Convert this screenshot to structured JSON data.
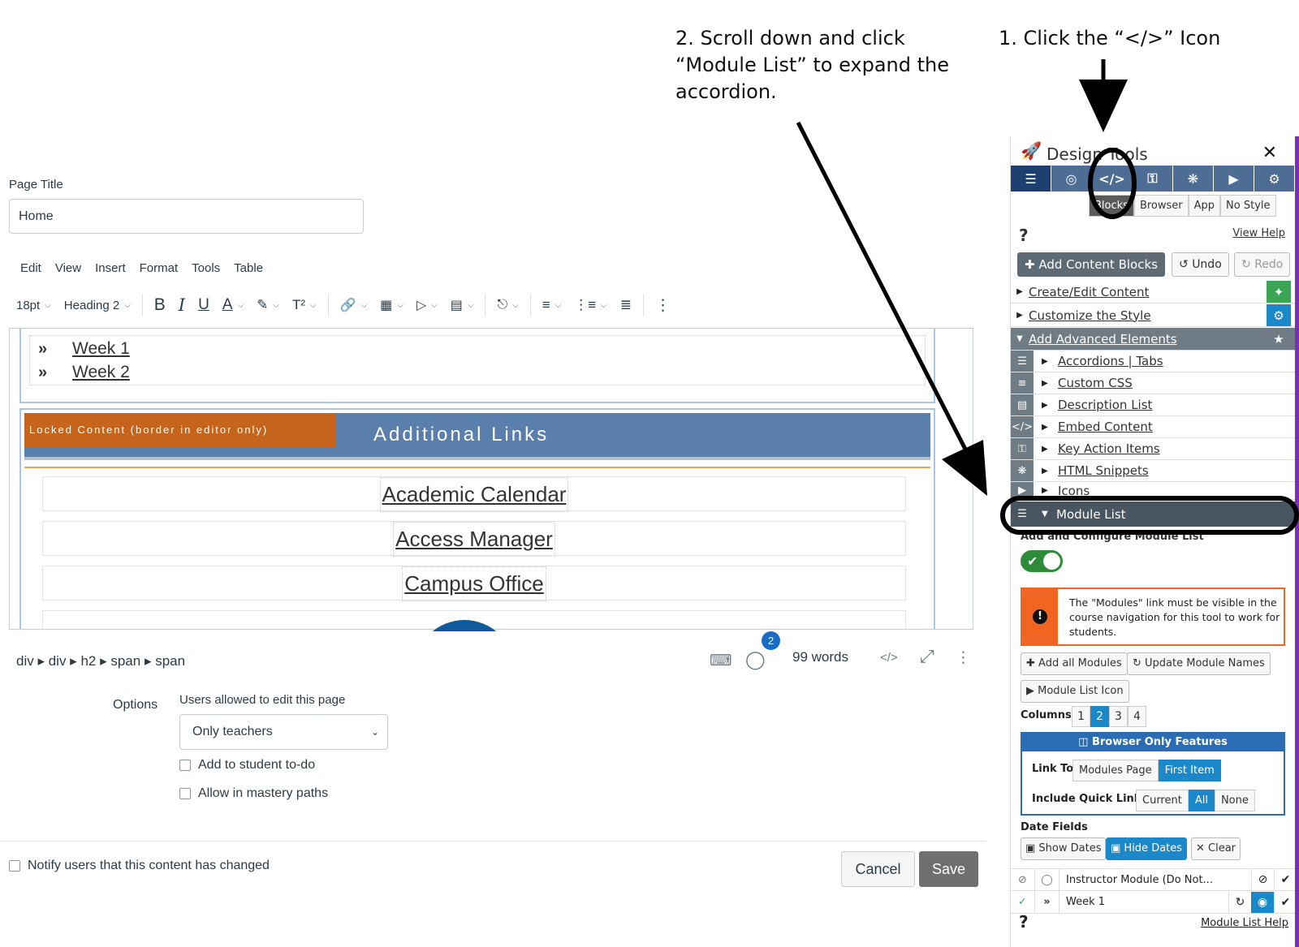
{
  "annotations": {
    "step1": "1. Click the “</>” Icon",
    "step2_lines": [
      "2. Scroll down and click",
      "“Module List” to expand the",
      "accordion."
    ]
  },
  "editor": {
    "page_title_label": "Page Title",
    "page_title_value": "Home",
    "menu": [
      "Edit",
      "View",
      "Insert",
      "Format",
      "Tools",
      "Table"
    ],
    "font_size": "18pt",
    "block_format": "Heading 2",
    "content": {
      "weeks": [
        "Week 1",
        "Week 2"
      ],
      "locked_label": "Locked Content (border in editor only)",
      "links_title": "Additional Links",
      "links": [
        "Academic Calendar",
        "Access Manager",
        "Campus Office"
      ]
    },
    "status": {
      "path": [
        "div",
        "div",
        "h2",
        "span",
        "span"
      ],
      "a11y_badge": "2",
      "word_count": "99 words"
    }
  },
  "options": {
    "label": "Options",
    "edit_label": "Users allowed to edit this page",
    "edit_value": "Only teachers",
    "todo_label": "Add to student to-do",
    "mastery_label": "Allow in mastery paths",
    "notify_label": "Notify users that this content has changed",
    "cancel": "Cancel",
    "save": "Save"
  },
  "panel": {
    "title": "Design Tools",
    "close": "✕",
    "modes": [
      "Blocks",
      "Browser",
      "App",
      "No Style"
    ],
    "view_help": "View Help",
    "add_content_blocks": "Add Content Blocks",
    "undo": "Undo",
    "redo": "Redo",
    "sections": [
      "Create/Edit Content",
      "Customize the Style",
      "Add Advanced Elements"
    ],
    "advanced": [
      "Accordions | Tabs",
      "Custom CSS",
      "Description List",
      "Embed Content",
      "Key Action Items",
      "HTML Snippets",
      "Icons"
    ],
    "module_list": "Module List",
    "configure_label": "Add and Configure Module List",
    "warning": "The \"Modules\" link must be visible in the course navigation for this tool to work for students.",
    "add_all_modules": "Add all Modules",
    "update_module_names": "Update Module Names",
    "module_list_icon": "Module List Icon",
    "columns_label": "Columns",
    "columns": [
      "1",
      "2",
      "3",
      "4"
    ],
    "browser_only": "Browser Only Features",
    "link_to_label": "Link To",
    "link_to": [
      "Modules Page",
      "First Item"
    ],
    "quick_links_label": "Include Quick Links",
    "quick_links": [
      "Current",
      "All",
      "None"
    ],
    "date_fields_label": "Date Fields",
    "show_dates": "Show Dates",
    "hide_dates": "Hide Dates",
    "clear": "Clear",
    "modules": [
      "Instructor Module (Do Not...",
      "Week 1"
    ],
    "module_list_help": "Module List Help"
  },
  "colors": {
    "editor_header_blue": "#5b7fad",
    "locked_orange": "#c6641c",
    "panel_tab_blue": "#4d6d94",
    "accent_blue": "#1a88c9",
    "warning_orange": "#f16522"
  }
}
